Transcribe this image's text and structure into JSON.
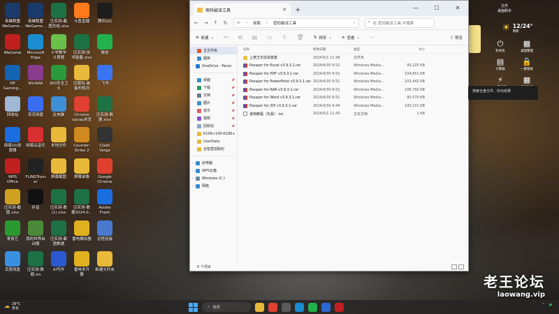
{
  "desktop_icons": [
    {
      "label": "英雄联盟\nWeGame...",
      "icon": "lol-icon",
      "color": "#1a3a6b"
    },
    {
      "label": "英雄联盟\nWeGame...",
      "icon": "lol-icon",
      "color": "#1a3a6b"
    },
    {
      "label": "压实测-截\n图总结.xlsx",
      "icon": "excel-icon",
      "color": "#1e7145"
    },
    {
      "label": "斗鱼直播",
      "icon": "douyu-icon",
      "color": "#ff7a1a"
    },
    {
      "label": "腾讯QQ",
      "icon": "qq-icon",
      "color": "#1d1d1d"
    },
    {
      "label": "WeGame",
      "icon": "wegame-icon",
      "color": "#c02020"
    },
    {
      "label": "Microsoft\nEdge",
      "icon": "edge-icon",
      "color": "#1b8ccf"
    },
    {
      "label": "小学数学\n计算题",
      "icon": "exe-icon",
      "color": "#6bbf4b"
    },
    {
      "label": "压实测-技\n术能量.xlsx",
      "icon": "excel-icon",
      "color": "#1e7145"
    },
    {
      "label": "微信",
      "icon": "wechat-icon",
      "color": "#22b14c"
    },
    {
      "label": "HP\nGaming...",
      "icon": "hp-icon",
      "color": "#1464b4"
    },
    {
      "label": "WinRAR",
      "icon": "winrar-icon",
      "color": "#8a3b8e"
    },
    {
      "label": "360安全卫\n士",
      "icon": "360-icon",
      "color": "#2b9a3c"
    },
    {
      "label": "压缩包-装\n备的规则",
      "icon": "folder-icon",
      "color": "#e8b93a"
    },
    {
      "label": "飞书",
      "icon": "feishu-icon",
      "color": "#3a74f0"
    },
    {
      "label": "回收站",
      "icon": "recycle-bin-icon",
      "color": "#9fb8d6"
    },
    {
      "label": "夸克网盘",
      "icon": "quark-icon",
      "color": "#3a6ef0"
    },
    {
      "label": "此电脑",
      "icon": "this-pc-icon",
      "color": "#3d8fd6"
    },
    {
      "label": "Chrome\nopcap浏览",
      "icon": "chrome-icon",
      "color": "#e04030"
    },
    {
      "label": "压实测-数\n据.xlsx",
      "icon": "excel-icon",
      "color": "#1e7145"
    },
    {
      "label": "网易UU加\n速器",
      "icon": "uu-icon",
      "color": "#1b6de0"
    },
    {
      "label": "网易云音乐",
      "icon": "music-icon",
      "color": "#d83030"
    },
    {
      "label": "本地文件",
      "icon": "folder-icon",
      "color": "#e8b93a"
    },
    {
      "label": "Counter-\nStrike 2",
      "icon": "cs2-icon",
      "color": "#d08a20"
    },
    {
      "label": "Clash\nVerge",
      "icon": "clash-icon",
      "color": "#333333"
    },
    {
      "label": "WPS\nOffice",
      "icon": "wps-icon",
      "color": "#c02020"
    },
    {
      "label": "FLiNGTrain\ner",
      "icon": "fling-icon",
      "color": "#222222"
    },
    {
      "label": "屏幕截图",
      "icon": "folder-icon",
      "color": "#e8b93a"
    },
    {
      "label": "屏幕录像",
      "icon": "folder-icon",
      "color": "#e8b93a"
    },
    {
      "label": "Google\nChrome",
      "icon": "chrome-icon",
      "color": "#e04030"
    },
    {
      "label": "压实测-截\n图.xlsx",
      "icon": "excel-icon",
      "color": "#d0a020"
    },
    {
      "label": "抖音",
      "icon": "douyin-icon",
      "color": "#111111"
    },
    {
      "label": "压实测-数\n(1).xlsx",
      "icon": "excel-icon",
      "color": "#1e7145"
    },
    {
      "label": "压实测-数\n据2024.0...",
      "icon": "excel-icon",
      "color": "#1e7145"
    },
    {
      "label": "Adobe\nFlash",
      "icon": "flash-icon",
      "color": "#1b6de0"
    },
    {
      "label": "爱奇艺",
      "icon": "iqiyi-icon",
      "color": "#2a9a30"
    },
    {
      "label": "我的世界启\n动器",
      "icon": "minecraft-icon",
      "color": "#4a8a3a"
    },
    {
      "label": "压实测-截\n图数据",
      "icon": "excel-icon",
      "color": "#1e7145"
    },
    {
      "label": "雷电模拟器",
      "icon": "ld-icon",
      "color": "#e0b020"
    },
    {
      "label": "远程连接",
      "icon": "remote-icon",
      "color": "#4a7ad0"
    },
    {
      "label": "百度网盘",
      "icon": "baidu-icon",
      "color": "#3a90e0"
    },
    {
      "label": "压实测-数\n据.xls",
      "icon": "excel-icon",
      "color": "#1e7145"
    },
    {
      "label": "AI写作",
      "icon": "ai-icon",
      "color": "#2a5ad0"
    },
    {
      "label": "雷电多开\n器",
      "icon": "ld-icon",
      "color": "#e0b020"
    },
    {
      "label": "新建文件夹",
      "icon": "folder-icon",
      "color": "#e8b93a"
    }
  ],
  "explorer": {
    "tab_title": "密码破译工具",
    "window_buttons": [
      "—",
      "☐",
      "✕"
    ],
    "breadcrumb": [
      "桌面",
      "密码破译工具"
    ],
    "search_placeholder": "在 密码破译工具 中搜索",
    "toolbar": {
      "new_label": "新建",
      "sort_label": "排序",
      "view_label": "查看",
      "more_label": "···",
      "preview_label": "预览"
    },
    "nav": [
      {
        "label": "主文件夹",
        "icon": "home-icon",
        "color": "#e05a3a",
        "selected": true
      },
      {
        "label": "图库",
        "icon": "gallery-icon",
        "color": "#3a8ad0"
      },
      {
        "label": "OneDrive - Perso",
        "icon": "onedrive-icon",
        "color": "#2a7ad0",
        "expandable": true
      },
      {
        "sep": true
      },
      {
        "label": "桌面",
        "icon": "desktop-icon",
        "color": "#3a8ad0",
        "pinned": true
      },
      {
        "label": "下载",
        "icon": "download-icon",
        "color": "#2a9a60",
        "pinned": true
      },
      {
        "label": "文档",
        "icon": "documents-icon",
        "color": "#6a7a8a",
        "pinned": true
      },
      {
        "label": "图片",
        "icon": "pictures-icon",
        "color": "#3a90d0",
        "pinned": true
      },
      {
        "label": "音乐",
        "icon": "music-icon",
        "color": "#e05a6a",
        "pinned": true
      },
      {
        "label": "视频",
        "icon": "videos-icon",
        "color": "#8a4ad0",
        "pinned": true
      },
      {
        "label": "回收站",
        "icon": "recycle-bin-icon",
        "color": "#8aa8c8",
        "pinned": true
      },
      {
        "label": "K106+100-K106+",
        "icon": "folder-icon",
        "color": "#e8b93a"
      },
      {
        "label": "UserData",
        "icon": "folder-icon",
        "color": "#e8b93a"
      },
      {
        "label": "台智营造股纪",
        "icon": "folder-icon",
        "color": "#e8b93a"
      },
      {
        "sep": true
      },
      {
        "label": "此电脑",
        "icon": "this-pc-icon",
        "color": "#3a8ad0",
        "expandable": true
      },
      {
        "label": "WPS云盘",
        "icon": "wps-cloud-icon",
        "color": "#3a8ad0",
        "expandable": true
      },
      {
        "label": "Windows (C:)",
        "icon": "drive-icon",
        "color": "#6a8aaa",
        "expandable": true
      },
      {
        "label": "网络",
        "icon": "network-icon",
        "color": "#3a8ad0",
        "expandable": true
      }
    ],
    "columns": [
      "名称",
      "修改日期",
      "类型",
      "大小"
    ],
    "files": [
      {
        "name": "上老王论坛找答案",
        "date": "2024/5/1 11:38",
        "type": "文件夹",
        "size": "",
        "kind": "folder"
      },
      {
        "name": "Passper for Excel v3.9.3.1.rar",
        "date": "2024/4/30 9:52",
        "type": "Windows Media...",
        "size": "95,225 KB",
        "kind": "rar"
      },
      {
        "name": "Passper for PDF v3.9.3.1.rar",
        "date": "2024/4/30 9:52",
        "type": "Windows Media...",
        "size": "104,851 KB",
        "kind": "rar"
      },
      {
        "name": "Passper for PowerPoint v3.9.3.1.rar",
        "date": "2024/4/30 9:51",
        "type": "Windows Media...",
        "size": "103,442 KB",
        "kind": "rar"
      },
      {
        "name": "Passper for RAR v3.9.3.1.rar",
        "date": "2024/4/30 9:52",
        "type": "Windows Media...",
        "size": "106,792 KB",
        "kind": "rar"
      },
      {
        "name": "Passper for Word v3.9.3.1.rar",
        "date": "2024/4/30 9:51",
        "type": "Windows Media...",
        "size": "95,570 KB",
        "kind": "rar"
      },
      {
        "name": "Passper for ZIP v3.9.3.1.rar",
        "date": "2024/4/30 9:44",
        "type": "Windows Media...",
        "size": "100,101 KB",
        "kind": "rar"
      },
      {
        "name": "使用教程（先看）.txt",
        "date": "2024/5/1 11:43",
        "type": "文本文档",
        "size": "1 KB",
        "kind": "txt"
      }
    ],
    "status_text": "8 个项目"
  },
  "right_panel": {
    "top_label": "文件\n桌面助手",
    "temperature": "12/24°",
    "weather_desc": "阴转",
    "items": [
      {
        "label": "秒关机",
        "icon": "power-icon"
      },
      {
        "label": "桌面整理",
        "icon": "desktop-organize-icon"
      },
      {
        "label": "计算器",
        "icon": "calculator-icon"
      },
      {
        "label": "一键锁屏",
        "icon": "lock-icon"
      },
      {
        "label": "一键加速",
        "icon": "speed-icon"
      },
      {
        "label": "表格助手",
        "icon": "table-icon"
      }
    ],
    "search_popup": "搜索全盘文件、秒出结果"
  },
  "taskbar": {
    "weather_temp": "29°C",
    "weather_desc": "多云",
    "search_placeholder": "搜索",
    "apps": [
      {
        "icon": "file-explorer-icon",
        "color": "#e8b93a"
      },
      {
        "icon": "chrome-icon",
        "color": "#e04030"
      },
      {
        "icon": "settings-icon",
        "color": "#5a5a5a"
      },
      {
        "icon": "edge-icon",
        "color": "#1b8ccf"
      },
      {
        "icon": "wechat-icon",
        "color": "#22b14c"
      },
      {
        "icon": "store-icon",
        "color": "#2a6ad0"
      },
      {
        "icon": "wps-icon",
        "color": "#c02020"
      }
    ]
  },
  "watermark": {
    "big": "老王论坛",
    "small": "laowang.vip"
  }
}
